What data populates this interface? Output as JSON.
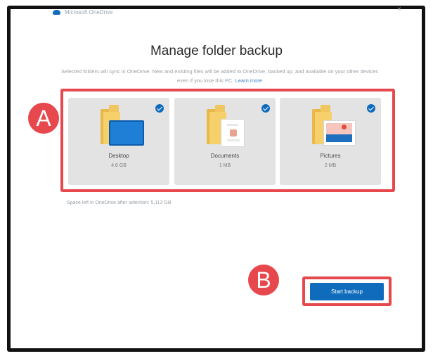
{
  "window": {
    "title": "Microsoft OneDrive",
    "close_glyph": "×"
  },
  "main": {
    "heading": "Manage folder backup",
    "description": "Selected folders will sync in OneDrive. New and existing files will be added to OneDrive, backed up, and available on your other devices even if you lose this PC.",
    "learn_more": "Learn more",
    "space_left": "Space left in OneDrive after selection: 5,113 GB",
    "folders": [
      {
        "label": "Desktop",
        "size": "4.6 GB",
        "icon": "desktop-folder-icon",
        "selected": true
      },
      {
        "label": "Documents",
        "size": "1 MB",
        "icon": "documents-folder-icon",
        "selected": true
      },
      {
        "label": "Pictures",
        "size": "2 MB",
        "icon": "pictures-folder-icon",
        "selected": true
      }
    ],
    "start_backup_label": "Start backup"
  },
  "annotations": {
    "a": "A",
    "b": "B",
    "highlight_color": "#e6484d"
  },
  "colors": {
    "accent": "#0f6cbd"
  }
}
